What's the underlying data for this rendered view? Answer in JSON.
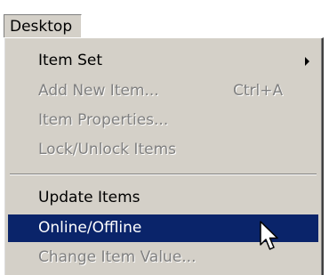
{
  "menubar": {
    "title": "Desktop"
  },
  "menu": {
    "items": [
      {
        "label": "Item Set",
        "shortcut": "",
        "disabled": false,
        "submenu": true
      },
      {
        "label": "Add New Item...",
        "shortcut": "Ctrl+A",
        "disabled": true
      },
      {
        "label": "Item Properties...",
        "shortcut": "",
        "disabled": true
      },
      {
        "label": "Lock/Unlock Items",
        "shortcut": "",
        "disabled": true
      },
      {
        "label": "Update Items",
        "shortcut": "",
        "disabled": false
      },
      {
        "label": "Online/Offline",
        "shortcut": "",
        "disabled": false,
        "selected": true
      },
      {
        "label": "Change Item Value...",
        "shortcut": "",
        "disabled": true
      }
    ]
  },
  "colors": {
    "menu_background": "#d4d0c8",
    "selection": "#0a246a",
    "disabled_text": "#808080"
  },
  "icons": {
    "submenu_arrow": "chevron-right-icon",
    "cursor": "mouse-pointer-icon"
  }
}
